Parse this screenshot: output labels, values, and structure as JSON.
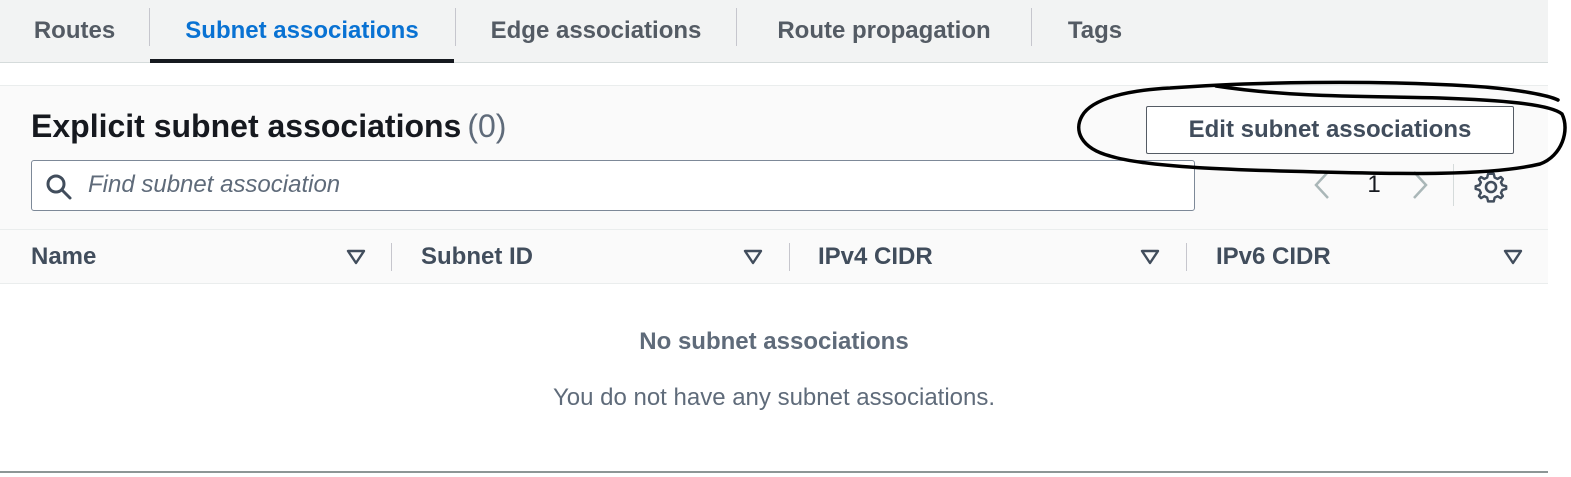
{
  "tabs": [
    {
      "label": "Routes",
      "active": false
    },
    {
      "label": "Subnet associations",
      "active": true
    },
    {
      "label": "Edge associations",
      "active": false
    },
    {
      "label": "Route propagation",
      "active": false
    },
    {
      "label": "Tags",
      "active": false
    }
  ],
  "panel": {
    "title": "Explicit subnet associations",
    "count": "(0)",
    "edit_button_label": "Edit subnet associations"
  },
  "search": {
    "placeholder": "Find subnet association",
    "value": "",
    "icon": "search-icon"
  },
  "pagination": {
    "current_page": "1",
    "prev_icon": "chevron-left-icon",
    "next_icon": "chevron-right-icon",
    "settings_icon": "gear-icon"
  },
  "table": {
    "columns": [
      {
        "label": "Name"
      },
      {
        "label": "Subnet ID"
      },
      {
        "label": "IPv4 CIDR"
      },
      {
        "label": "IPv6 CIDR"
      }
    ],
    "rows": [],
    "empty_title": "No subnet associations",
    "empty_description": "You do not have any subnet associations."
  },
  "colors": {
    "accent": "#0972d3",
    "text": "#16191f",
    "muted": "#5f6b7a",
    "header_bg": "#fafafa",
    "tab_bg": "#f2f3f3"
  }
}
